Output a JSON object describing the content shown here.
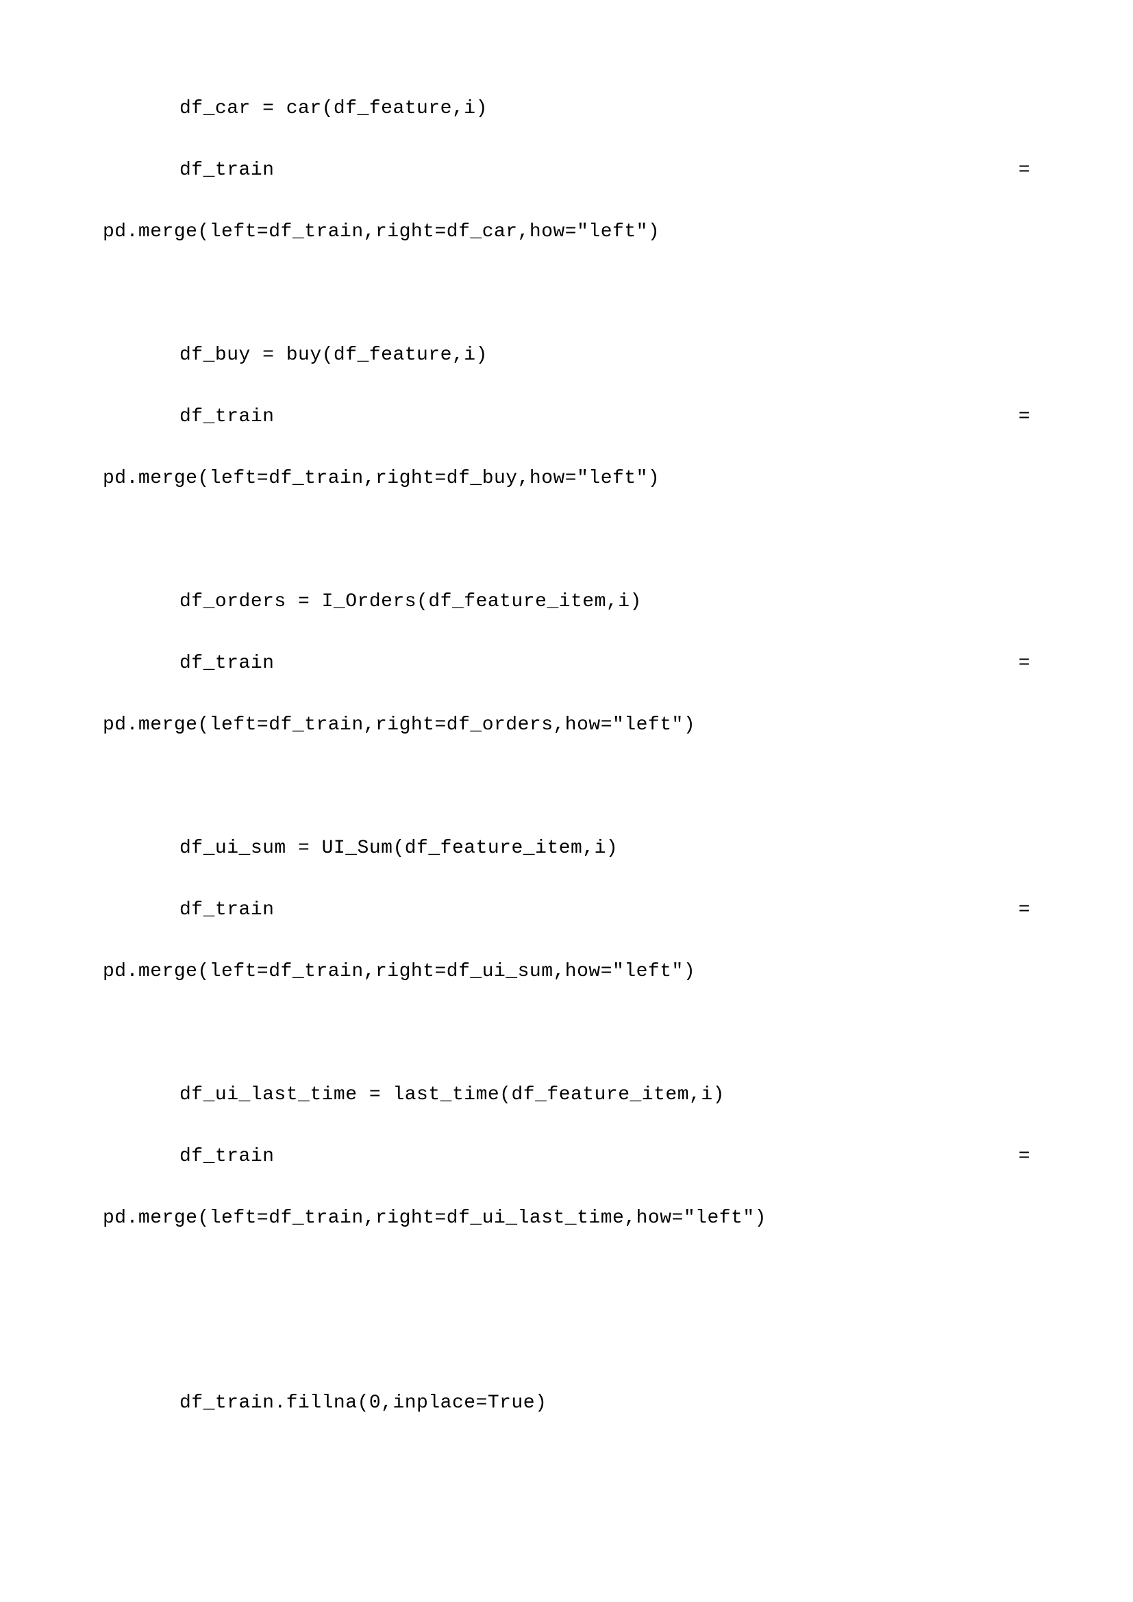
{
  "code": {
    "line1": "df_car = car(df_feature,i)",
    "line2_left": "df_train",
    "line2_right": "=",
    "line3": "pd.merge(left=df_train,right=df_car,how=\"left\")",
    "line4": "df_buy = buy(df_feature,i)",
    "line5_left": "df_train",
    "line5_right": "=",
    "line6": "pd.merge(left=df_train,right=df_buy,how=\"left\")",
    "line7": "df_orders = I_Orders(df_feature_item,i)",
    "line8_left": "df_train",
    "line8_right": "=",
    "line9": "pd.merge(left=df_train,right=df_orders,how=\"left\")",
    "line10": "df_ui_sum = UI_Sum(df_feature_item,i)",
    "line11_left": "df_train",
    "line11_right": "=",
    "line12": "pd.merge(left=df_train,right=df_ui_sum,how=\"left\")",
    "line13": "df_ui_last_time = last_time(df_feature_item,i)",
    "line14_left": "df_train",
    "line14_right": "=",
    "line15": "pd.merge(left=df_train,right=df_ui_last_time,how=\"left\")",
    "line16": "df_train.fillna(0,inplace=True)"
  }
}
